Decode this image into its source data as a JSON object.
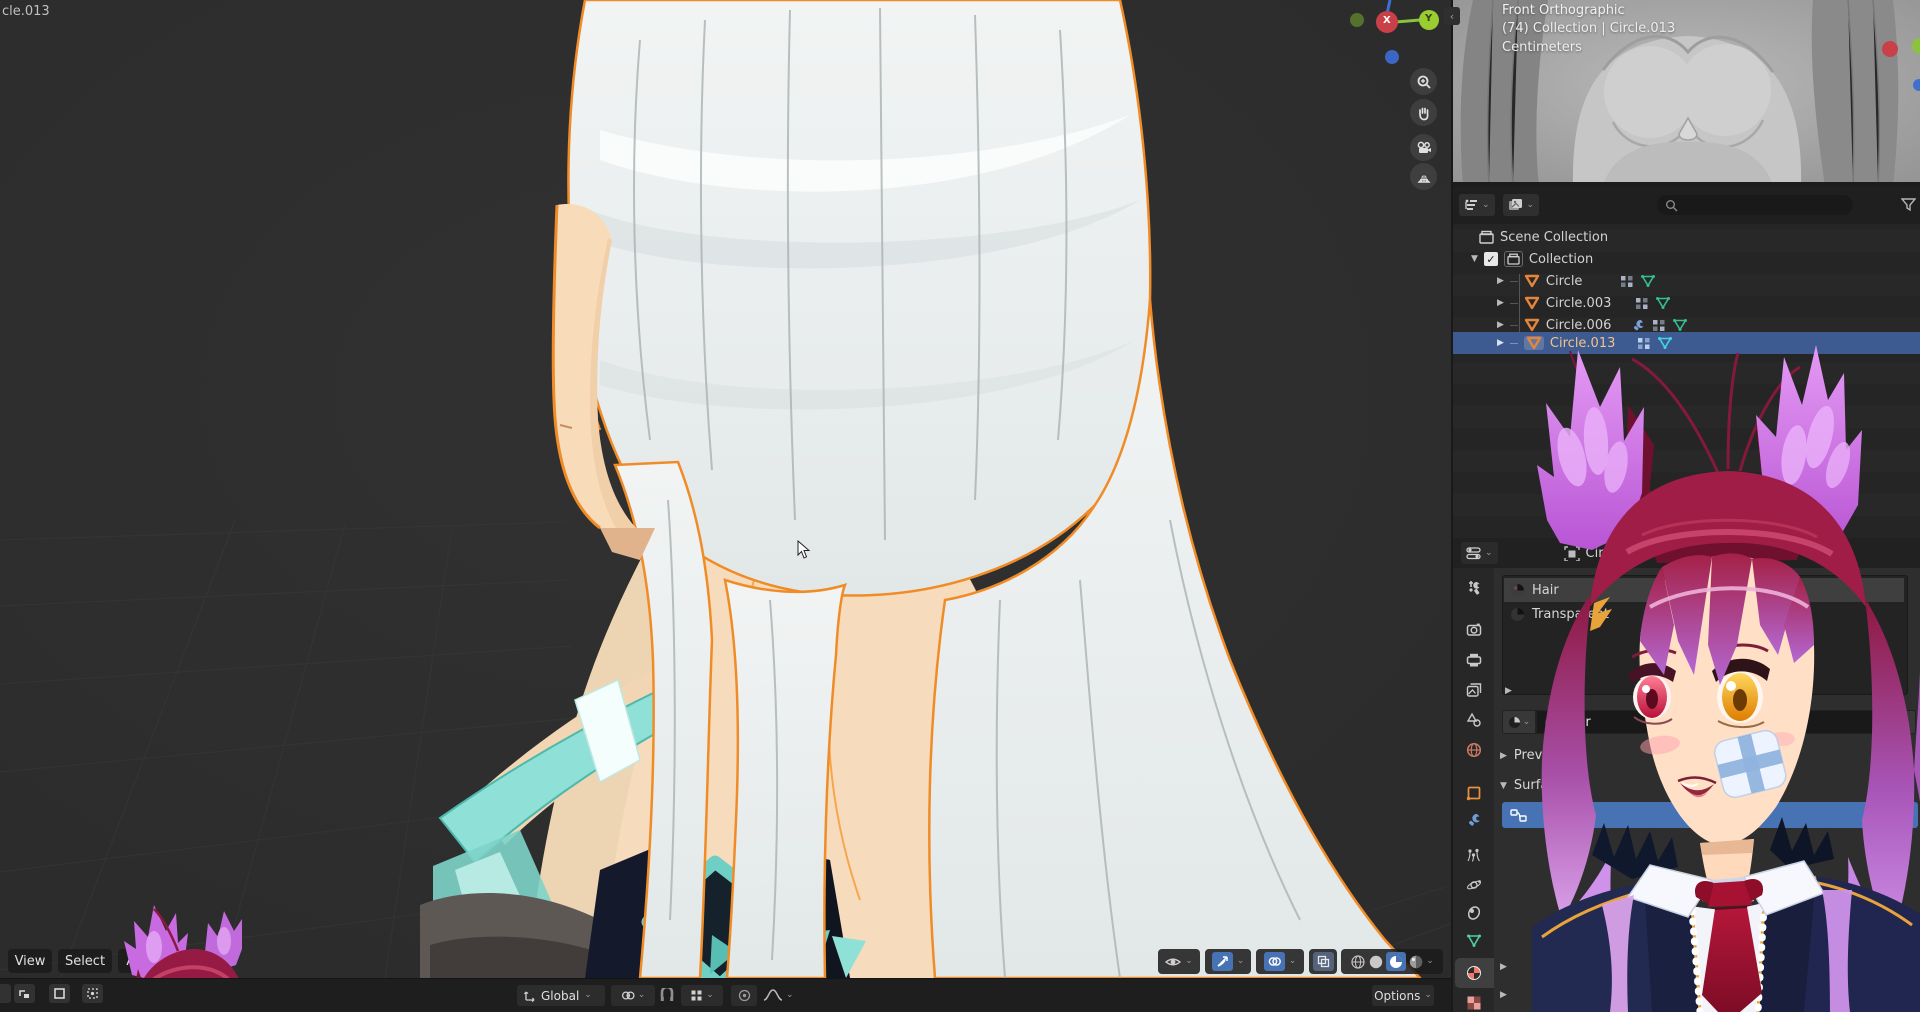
{
  "app": {
    "title": "Blender 3D viewport with outliner and material properties",
    "colors": {
      "accent_blue": "#4772b3",
      "selection_row_blue": "#3d5a91",
      "selection_outline_orange": "#f08c28",
      "viewport_bg": "#2e2e2e",
      "panel_bg": "#2e2e2e",
      "header_bg": "#1e1e1e"
    }
  },
  "viewport": {
    "corner_label": "cle.013",
    "gizmo": {
      "x_label": "X",
      "y_label": "Y"
    },
    "nav_buttons": [
      "zoom-icon",
      "pan-hand-icon",
      "camera-icon",
      "grid-icon"
    ],
    "menus": {
      "view": "View",
      "select": "Select",
      "add": "Add"
    },
    "header": {
      "orientation_label": "Global",
      "options_label": "Options"
    }
  },
  "preview": {
    "line1": "Front Orthographic",
    "line2": "(74) Collection | Circle.013",
    "line3": "Centimeters"
  },
  "outliner": {
    "scene_collection": "Scene Collection",
    "collection": "Collection",
    "items": [
      {
        "name": "Circle",
        "selected": false,
        "has_wrench": false
      },
      {
        "name": "Circle.003",
        "selected": false,
        "has_wrench": false
      },
      {
        "name": "Circle.006",
        "selected": false,
        "has_wrench": true
      },
      {
        "name": "Circle.013",
        "selected": true,
        "has_wrench": false
      }
    ]
  },
  "properties": {
    "breadcrumb": "Circle.013",
    "slot1": "Hair",
    "slot2": "Transparent",
    "material_name": "Hair",
    "preview_section": "Preview",
    "surface_section": "Surface"
  },
  "icons": {
    "outliner-editor-icon": "tree-list",
    "display-mode-icon": "photo-stack",
    "search-icon": "magnifier",
    "filter-icon": "funnel",
    "mesh-object-icon": "orange triangle",
    "mesh-data-icon": "green triangle",
    "modifier-wrench-icon": "wrench",
    "material-icon": "shaded sphere",
    "use-nodes-icon": "node squares",
    "close-icon": "x"
  }
}
